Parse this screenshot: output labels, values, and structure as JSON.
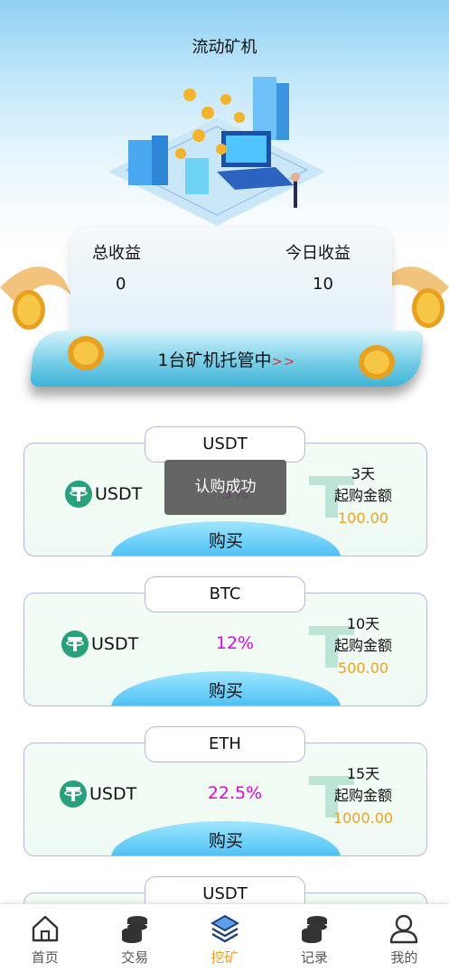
{
  "header": {
    "title": "流动矿机"
  },
  "summary": {
    "total_label": "总收益",
    "total_value": "0",
    "today_label": "今日收益",
    "today_value": "10",
    "hosted_text": "1台矿机托管中",
    "hosted_arrow": ">>"
  },
  "products": [
    {
      "tab": "USDT",
      "coin": "USDT",
      "rate": "3%",
      "days": "3天",
      "min_label": "起购金额",
      "min_value": "100.00",
      "buy": "购买"
    },
    {
      "tab": "BTC",
      "coin": "USDT",
      "rate": "12%",
      "days": "10天",
      "min_label": "起购金额",
      "min_value": "500.00",
      "buy": "购买"
    },
    {
      "tab": "ETH",
      "coin": "USDT",
      "rate": "22.5%",
      "days": "15天",
      "min_label": "起购金额",
      "min_value": "1000.00",
      "buy": "购买"
    },
    {
      "tab": "USDT"
    }
  ],
  "toast": {
    "message": "认购成功"
  },
  "tabbar": {
    "items": [
      {
        "label": "首页",
        "icon": "home-icon"
      },
      {
        "label": "交易",
        "icon": "coins-stack-icon"
      },
      {
        "label": "挖矿",
        "icon": "layers-icon",
        "active": true
      },
      {
        "label": "记录",
        "icon": "coins-stack-icon"
      },
      {
        "label": "我的",
        "icon": "user-icon"
      }
    ]
  },
  "colors": {
    "accent": "#f0a020",
    "rate": "#e800e8",
    "tether": "#26a17b",
    "buy_button": "#4cc0f4"
  }
}
